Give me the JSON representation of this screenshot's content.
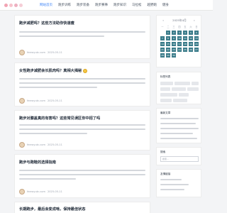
{
  "site": {
    "logo_alt": "site-logo"
  },
  "nav": {
    "items": [
      {
        "label": "网站首页",
        "active": true
      },
      {
        "label": "跑步训练",
        "active": false
      },
      {
        "label": "跑步装备",
        "active": false
      },
      {
        "label": "跑步赛事",
        "active": false
      },
      {
        "label": "跑步知识",
        "active": false
      },
      {
        "label": "马拉松",
        "active": false
      },
      {
        "label": "越野跑",
        "active": false
      },
      {
        "label": "健身",
        "active": false
      }
    ]
  },
  "posts": [
    {
      "title": "跑步减肥吗？这些方法助你快速瘦",
      "has_emoji": false,
      "author": "feerayutc.com",
      "date": "2025-05-11"
    },
    {
      "title": "女性跑步减肥会长肌肉吗？真相大揭秘",
      "has_emoji": true,
      "author": "feerayutc.com",
      "date": "2025-05-11"
    },
    {
      "title": "跑步对膝盖真的有害吗？这些常见误区你中招了吗",
      "has_emoji": false,
      "author": "feerayutc.com",
      "date": "2025-05-11"
    },
    {
      "title": "跑步与跑鞋的选择指南",
      "has_emoji": false,
      "author": "feerayutc.com",
      "date": "2025-05-11"
    },
    {
      "title": "长期跑步，最后会变成啥，保持最佳状态",
      "has_emoji": false,
      "author": "",
      "date": ""
    }
  ],
  "calendar": {
    "month_label": "2025年4月",
    "prev": "«",
    "next": "»",
    "weekdays": [
      "一",
      "二",
      "三",
      "四",
      "五",
      "六",
      "日"
    ],
    "days": [
      "",
      "1",
      "2",
      "3",
      "4",
      "5",
      "6",
      "7",
      "8",
      "9",
      "10",
      "11",
      "12",
      "13",
      "14",
      "15",
      "16",
      "17",
      "18",
      "19",
      "20",
      "21",
      "22",
      "23",
      "24",
      "25",
      "26",
      "27",
      "28",
      "29",
      "30",
      "",
      "",
      "",
      ""
    ]
  },
  "sidebar": {
    "tags_title": "标签列表",
    "latest_title": "最新文章",
    "search_title": "搜索",
    "search_placeholder": "搜索...",
    "friends_title": "友情链接"
  },
  "colors": {
    "accent": "#3b7c8a",
    "nav_active": "#3b82f6",
    "title": "#1f2937"
  }
}
